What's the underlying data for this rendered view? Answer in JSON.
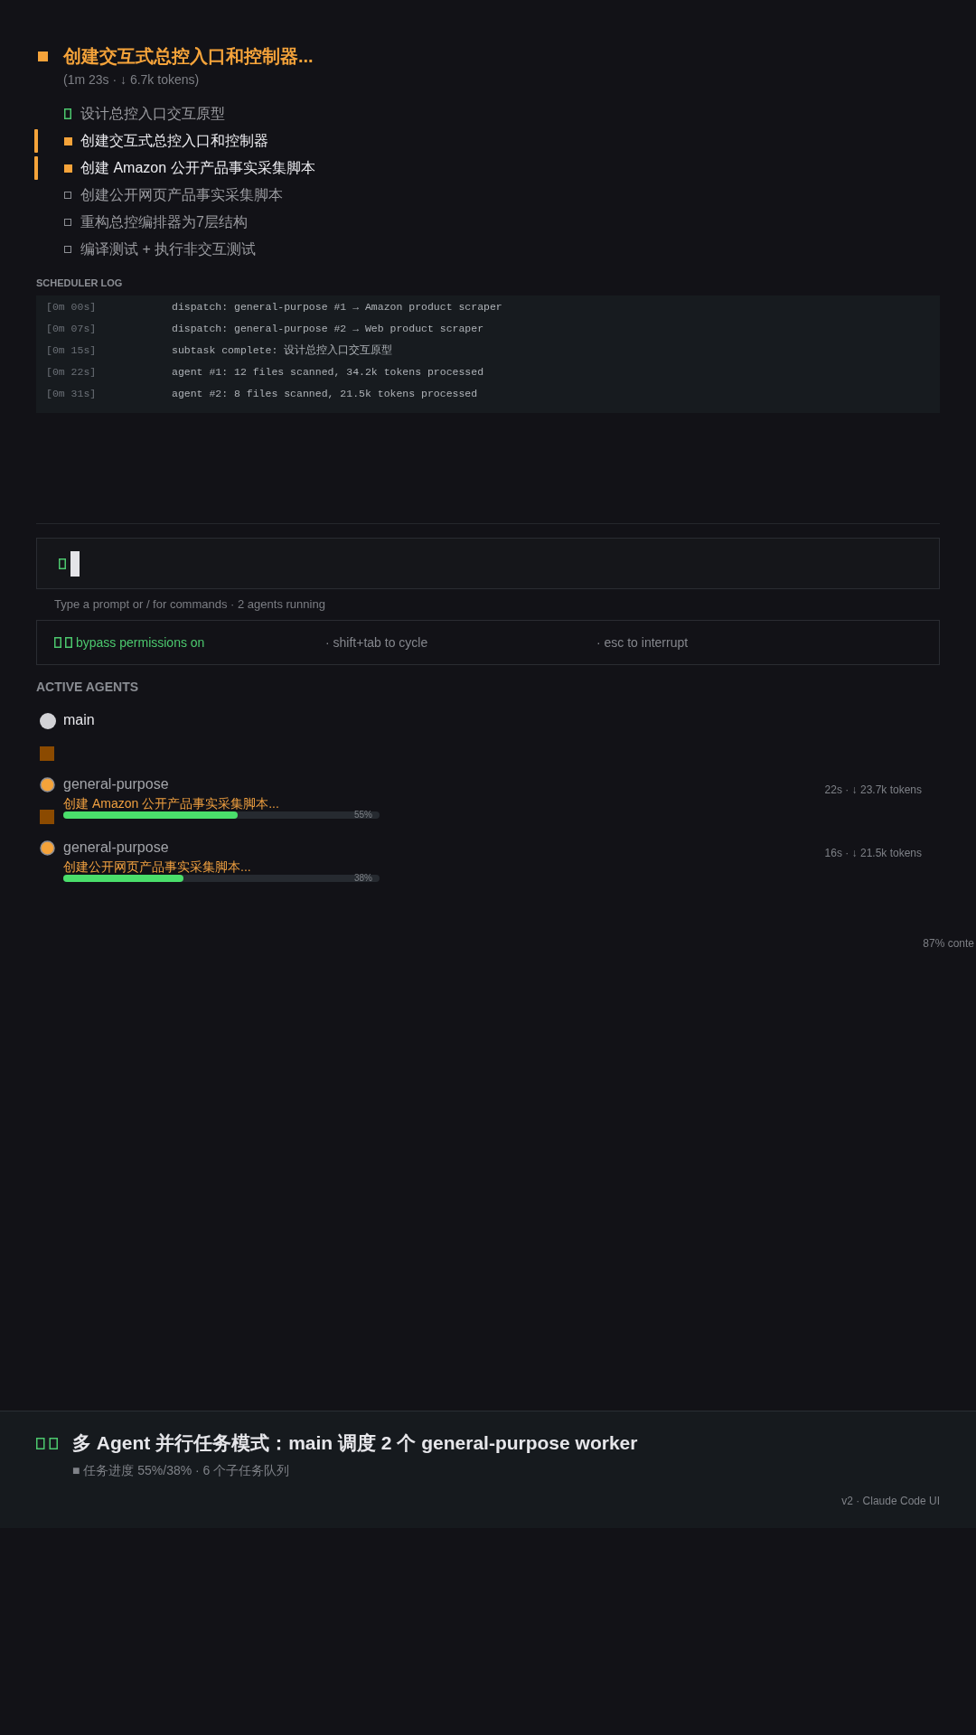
{
  "task": {
    "title": "创建交互式总控入口和控制器...",
    "meta": "(1m 23s · ↓ 6.7k tokens)"
  },
  "subtasks": [
    {
      "label": "设计总控入口交互原型",
      "kind": "done"
    },
    {
      "label": "创建交互式总控入口和控制器",
      "kind": "active"
    },
    {
      "label": "创建 Amazon 公开产品事实采集脚本",
      "kind": "active"
    },
    {
      "label": "创建公开网页产品事实采集脚本",
      "kind": "pending"
    },
    {
      "label": "重构总控编排器为7层结构",
      "kind": "pending"
    },
    {
      "label": "编译测试 + 执行非交互测试",
      "kind": "pending"
    }
  ],
  "scheduler_log": {
    "title": "SCHEDULER LOG",
    "entries": [
      {
        "time": "[0m 00s]",
        "message": "dispatch: general-purpose #1 → Amazon product scraper"
      },
      {
        "time": "[0m 07s]",
        "message": "dispatch: general-purpose #2 → Web product scraper"
      },
      {
        "time": "[0m 15s]",
        "message": "subtask complete: 设计总控入口交互原型"
      },
      {
        "time": "[0m 22s]",
        "message": "agent #1: 12 files scanned, 34.2k tokens processed"
      },
      {
        "time": "[0m 31s]",
        "message": "agent #2: 8 files scanned, 21.5k tokens processed"
      }
    ]
  },
  "prompt": {
    "hint": "Type a prompt or / for commands · 2 agents running"
  },
  "mode_bar": {
    "status": "bypass permissions on",
    "shortcuts": [
      "· shift+tab to cycle",
      "· esc to interrupt"
    ]
  },
  "active_agents": {
    "title": "ACTIVE AGENTS",
    "agents": [
      {
        "name": "main",
        "kind": "main"
      },
      {
        "name": "general-purpose",
        "kind": "worker",
        "task": "创建 Amazon 公开产品事实采集脚本...",
        "level": 0.55,
        "reading": "55%",
        "stats": "22s · ↓ 23.7k tokens"
      },
      {
        "name": "general-purpose",
        "kind": "worker",
        "task": "创建公开网页产品事实采集脚本...",
        "level": 0.38,
        "reading": "38%",
        "stats": "16s · ↓ 21.5k tokens"
      }
    ]
  },
  "context": "87% conte",
  "footer": {
    "title": "多 Agent 并行任务模式：main 调度 2 个 general-purpose worker",
    "subtitle": "■ 任务进度 55%/38% · 6 个子任务队列",
    "version": "v2 · Claude Code UI"
  }
}
